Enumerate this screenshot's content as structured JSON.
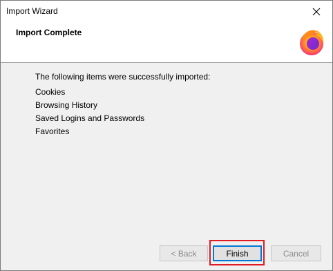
{
  "window": {
    "title": "Import Wizard"
  },
  "header": {
    "title": "Import Complete",
    "logo_icon": "firefox-logo-icon"
  },
  "content": {
    "intro": "The following items were successfully imported:",
    "items": [
      "Cookies",
      "Browsing History",
      "Saved Logins and Passwords",
      "Favorites"
    ]
  },
  "buttons": {
    "back_label": "< Back",
    "finish_label": "Finish",
    "cancel_label": "Cancel"
  },
  "colors": {
    "default_button_border": "#0078d7",
    "highlight_box": "#e01b24"
  }
}
